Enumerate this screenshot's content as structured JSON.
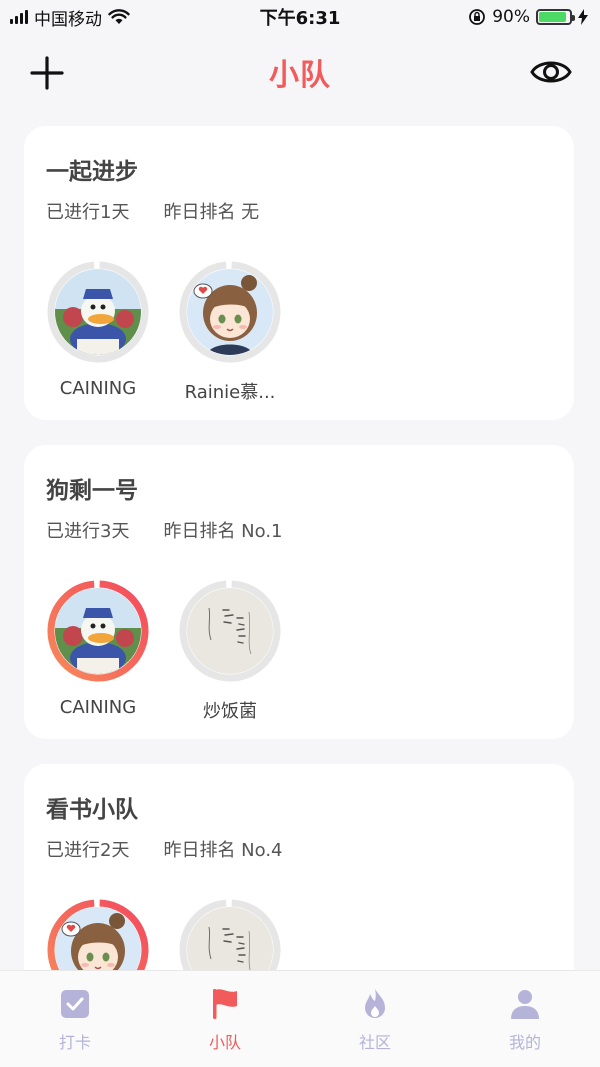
{
  "status_bar": {
    "carrier": "中国移动",
    "time": "下午6:31",
    "battery_percent": "90%",
    "battery_level": 0.9
  },
  "navbar": {
    "title": "小队",
    "add_icon": "plus-icon",
    "eye_icon": "eye-icon"
  },
  "colors": {
    "accent": "#f25b5b",
    "tab_inactive": "#b6b3d9",
    "ring_gray": "#e6e6e6",
    "ring_red_start": "#f78a5a",
    "ring_red_end": "#f2495e"
  },
  "teams": [
    {
      "name": "一起进步",
      "days": "已进行1天",
      "rank": "昨日排名 无",
      "members": [
        {
          "name": "CAINING",
          "avatar": "donald-duck-avatar",
          "progress_state": "gray"
        },
        {
          "name": "Rainie慕...",
          "avatar": "anime-girl-avatar",
          "progress_state": "gray"
        }
      ]
    },
    {
      "name": "狗剩一号",
      "days": "已进行3天",
      "rank": "昨日排名 No.1",
      "members": [
        {
          "name": "CAINING",
          "avatar": "donald-duck-avatar",
          "progress_state": "red"
        },
        {
          "name": "炒饭菌",
          "avatar": "handwriting-avatar",
          "progress_state": "gray"
        }
      ]
    },
    {
      "name": "看书小队",
      "days": "已进行2天",
      "rank": "昨日排名 No.4",
      "members": [
        {
          "name": "",
          "avatar": "anime-girl-avatar",
          "progress_state": "red"
        },
        {
          "name": "",
          "avatar": "handwriting-avatar",
          "progress_state": "gray"
        }
      ]
    }
  ],
  "tabs": [
    {
      "label": "打卡",
      "icon": "checkin-icon",
      "active": false
    },
    {
      "label": "小队",
      "icon": "flag-icon",
      "active": true
    },
    {
      "label": "社区",
      "icon": "flame-icon",
      "active": false
    },
    {
      "label": "我的",
      "icon": "person-icon",
      "active": false
    }
  ]
}
